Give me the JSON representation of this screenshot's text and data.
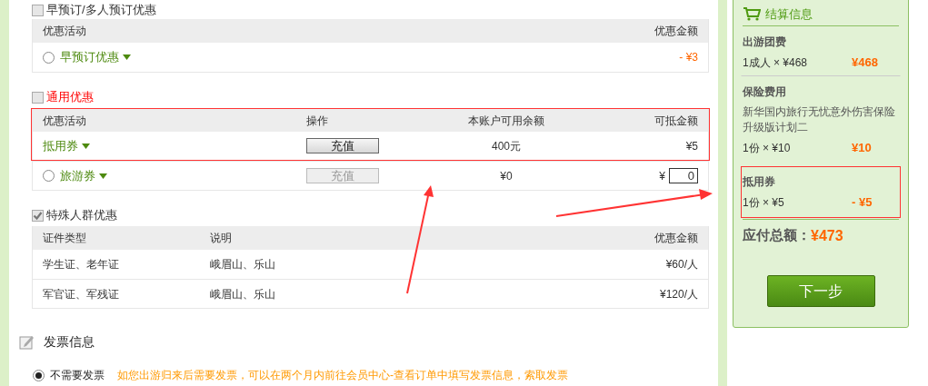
{
  "early_booking": {
    "label": "早预订/多人预订优惠",
    "checked": false,
    "columns": [
      "优惠活动",
      "优惠金额"
    ],
    "rows": [
      {
        "selected": false,
        "name": "早预订优惠",
        "amount": "- ¥3"
      }
    ]
  },
  "general": {
    "label": "通用优惠",
    "checked": false,
    "annotated": true,
    "columns": [
      "优惠活动",
      "操作",
      "本账户可用余额",
      "可抵金额"
    ],
    "rows": [
      {
        "kind": "plain",
        "name": "抵用券",
        "button": {
          "label": "充值",
          "disabled": false
        },
        "balance": "400元",
        "amount": "¥5"
      },
      {
        "kind": "radio",
        "selected": false,
        "name": "旅游券",
        "button": {
          "label": "充值",
          "disabled": true
        },
        "balance": "¥0",
        "currency": "¥",
        "value": "0"
      }
    ]
  },
  "special": {
    "label": "特殊人群优惠",
    "checked": true,
    "columns": [
      "证件类型",
      "说明",
      "优惠金额"
    ],
    "rows": [
      [
        "学生证、老年证",
        "峨眉山、乐山",
        "¥60/人"
      ],
      [
        "军官证、军残证",
        "峨眉山、乐山",
        "¥120/人"
      ]
    ]
  },
  "invoice": {
    "title": "发票信息",
    "option": {
      "label": "不需要发票",
      "selected": true
    },
    "note": "如您出游归来后需要发票，可以在两个月内前往会员中心-查看订单中填写发票信息，索取发票"
  },
  "summary": {
    "title": "结算信息",
    "groups": [
      {
        "title": "出游团费",
        "annotated": false,
        "lines": [
          {
            "desc": "1成人 × ¥468",
            "amount": "¥468"
          }
        ]
      },
      {
        "title": "保险费用",
        "annotated": false,
        "detail": "新华国内旅行无忧意外伤害保险升级版计划二",
        "lines": [
          {
            "desc": "1份 × ¥10",
            "amount": "¥10"
          }
        ]
      },
      {
        "title": "抵用券",
        "annotated": true,
        "lines": [
          {
            "desc": "1份 × ¥5",
            "amount": "- ¥5"
          }
        ]
      }
    ],
    "total_label": "应付总额：",
    "total": "¥473",
    "next_button": "下一步"
  }
}
